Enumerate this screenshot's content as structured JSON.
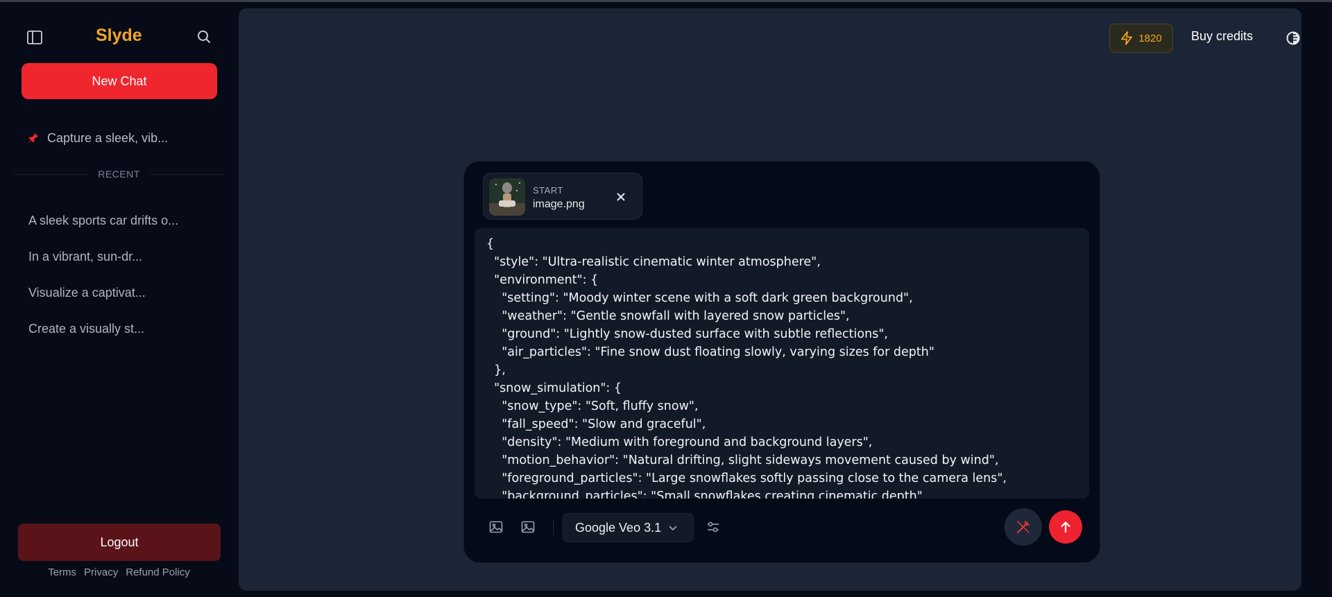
{
  "app": {
    "brand": "Slyde"
  },
  "sidebar": {
    "new_chat_label": "New Chat",
    "pinned": [
      {
        "label": "Capture a sleek, vib..."
      }
    ],
    "recent_label": "RECENT",
    "recent": [
      {
        "label": "A sleek sports car drifts o..."
      },
      {
        "label": "In a vibrant, sun-dr..."
      },
      {
        "label": "Visualize a captivat..."
      },
      {
        "label": "Create a visually st..."
      }
    ],
    "logout_label": "Logout",
    "footer": {
      "terms": "Terms",
      "privacy": "Privacy",
      "refund": "Refund Policy"
    }
  },
  "header": {
    "credits": "1820",
    "buy_credits_label": "Buy credits"
  },
  "composer": {
    "attachment": {
      "tag": "START",
      "filename": "image.png"
    },
    "prompt_text": "{\n  \"style\": \"Ultra-realistic cinematic winter atmosphere\",\n  \"environment\": {\n    \"setting\": \"Moody winter scene with a soft dark green background\",\n    \"weather\": \"Gentle snowfall with layered snow particles\",\n    \"ground\": \"Lightly snow-dusted surface with subtle reflections\",\n    \"air_particles\": \"Fine snow dust floating slowly, varying sizes for depth\"\n  },\n  \"snow_simulation\": {\n    \"snow_type\": \"Soft, fluffy snow\",\n    \"fall_speed\": \"Slow and graceful\",\n    \"density\": \"Medium with foreground and background layers\",\n    \"motion_behavior\": \"Natural drifting, slight sideways movement caused by wind\",\n    \"foreground_particles\": \"Large snowflakes softly passing close to the camera lens\",\n    \"background_particles\": \"Small snowflakes creating cinematic depth\"",
    "model_selected": "Google Veo 3.1"
  },
  "colors": {
    "accent_red": "#f0262f",
    "brand_gold": "#f5a623",
    "logout_bg": "#5a1419",
    "main_bg": "#1c2535"
  },
  "icons": {
    "sidebar_toggle": "sidebar-toggle-icon",
    "search": "search-icon",
    "pin": "pin-icon",
    "lightning": "lightning-icon",
    "theme": "theme-toggle-icon",
    "close": "close-icon",
    "image": "image-icon",
    "chevron": "chevron-down-icon",
    "sliders": "sliders-icon",
    "enhance": "magic-wand-icon",
    "send": "arrow-up-icon"
  }
}
